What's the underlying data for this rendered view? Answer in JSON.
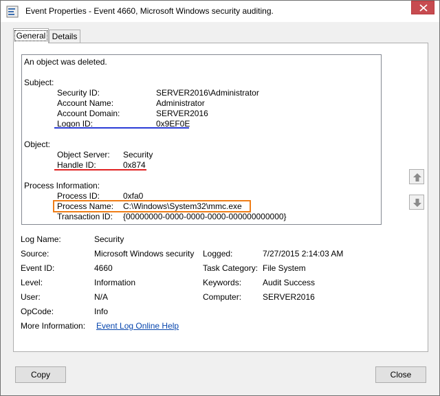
{
  "window": {
    "title": "Event Properties - Event 4660, Microsoft Windows security auditing."
  },
  "tabs": [
    {
      "label": "General"
    },
    {
      "label": "Details"
    }
  ],
  "description": {
    "headline": "An object was deleted.",
    "subject": {
      "heading": "Subject:",
      "security_id_label": "Security ID:",
      "security_id": "SERVER2016\\Administrator",
      "account_name_label": "Account Name:",
      "account_name": "Administrator",
      "account_domain_label": "Account Domain:",
      "account_domain": "SERVER2016",
      "logon_id_label": "Logon ID:",
      "logon_id": "0x9EF0E"
    },
    "object": {
      "heading": "Object:",
      "object_server_label": "Object Server:",
      "object_server": "Security",
      "handle_id_label": "Handle ID:",
      "handle_id": "0x874"
    },
    "process": {
      "heading": "Process Information:",
      "process_id_label": "Process ID:",
      "process_id": "0xfa0",
      "process_name_label": "Process Name:",
      "process_name": "C:\\Windows\\System32\\mmc.exe",
      "transaction_id_label": "Transaction ID:",
      "transaction_id": "{00000000-0000-0000-0000-000000000000}"
    }
  },
  "fields": {
    "log_name_label": "Log Name:",
    "log_name": "Security",
    "source_label": "Source:",
    "source": "Microsoft Windows security",
    "logged_label": "Logged:",
    "logged": "7/27/2015 2:14:03 AM",
    "event_id_label": "Event ID:",
    "event_id": "4660",
    "task_category_label": "Task Category:",
    "task_category": "File System",
    "level_label": "Level:",
    "level": "Information",
    "keywords_label": "Keywords:",
    "keywords": "Audit Success",
    "user_label": "User:",
    "user": "N/A",
    "computer_label": "Computer:",
    "computer": "SERVER2016",
    "opcode_label": "OpCode:",
    "opcode": "Info",
    "more_info_label": "More Information:",
    "more_info_link": "Event Log Online Help"
  },
  "buttons": {
    "copy": "Copy",
    "close": "Close"
  },
  "colors": {
    "close_button": "#c74b50",
    "underline_blue": "#2a3bd6",
    "underline_red": "#e02020",
    "highlight_orange": "#ef7d16",
    "link": "#0645ad"
  },
  "icons": {
    "app": "event-viewer-icon",
    "close": "close-icon",
    "scroll_up": "arrow-up-icon",
    "scroll_down": "arrow-down-icon"
  }
}
